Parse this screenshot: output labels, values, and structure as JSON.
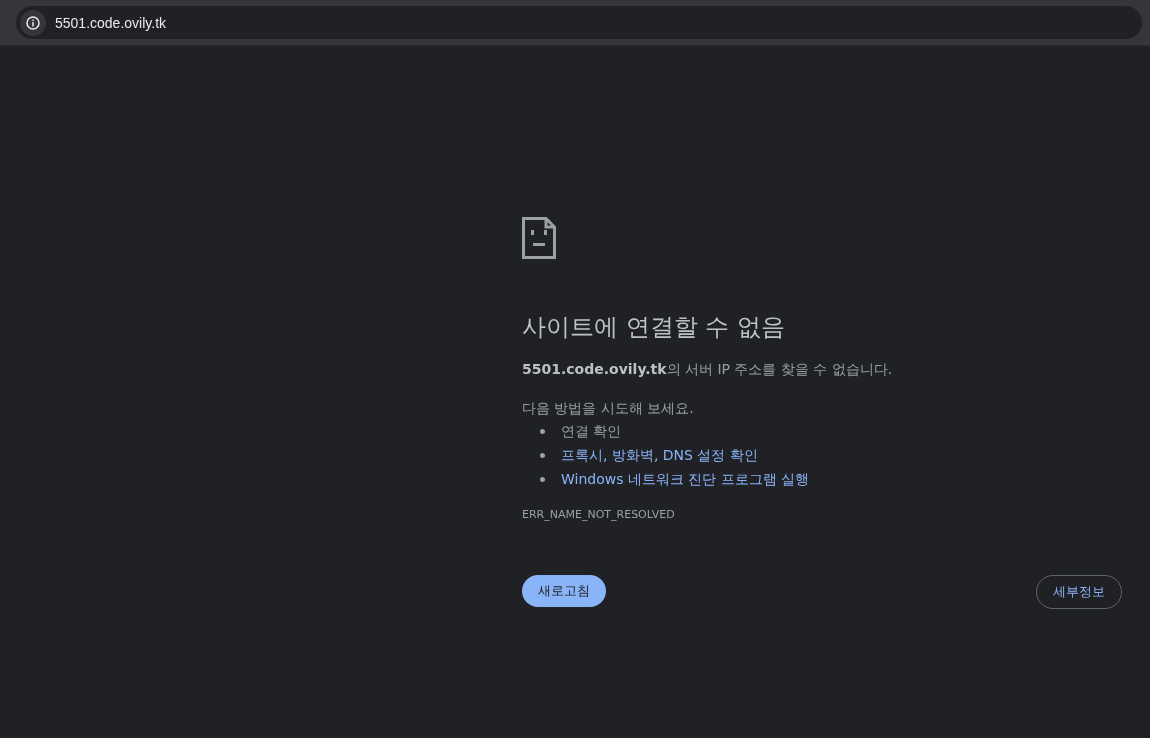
{
  "address_bar": {
    "url": "5501.code.ovily.tk"
  },
  "error": {
    "title": "사이트에 연결할 수 없음",
    "description": "**5501.code.ovily.tk**의 서버 IP 주소를 찾을 수 없습니다.",
    "suggestions_heading": "다음 방법을 시도해 보세요.",
    "suggestions": [
      {
        "kind": "text",
        "label": "연결 확인"
      },
      {
        "kind": "link",
        "label": "프록시, 방화벽, DNS 설정 확인"
      },
      {
        "kind": "link",
        "label": "Windows 네트워크 진단 프로그램 실행"
      }
    ],
    "code": "ERR_NAME_NOT_RESOLVED"
  },
  "buttons": {
    "reload": "새로고침",
    "details": "세부정보"
  }
}
